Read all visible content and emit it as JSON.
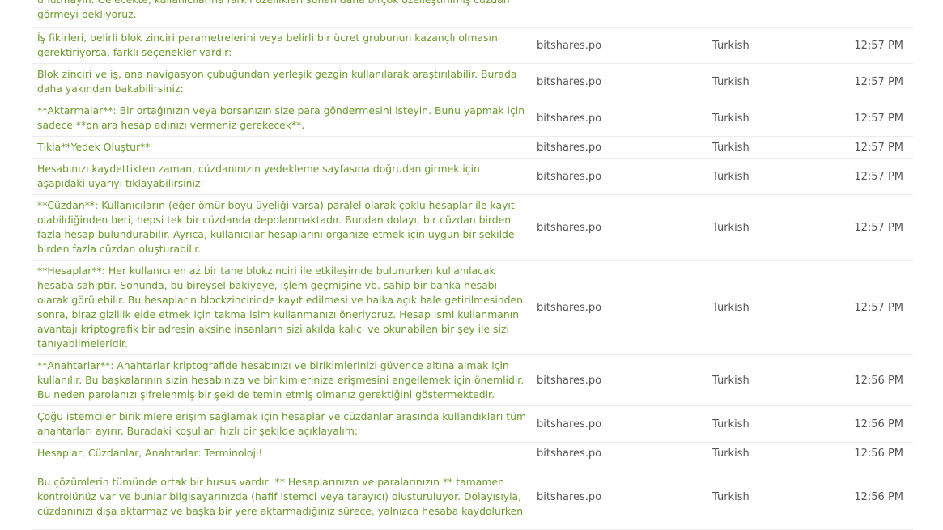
{
  "rows": [
    {
      "text": "unutmayın. Gelecekte, kullanıcılarına farklı özellikleri sunan daha birçok özelleştirilmiş cüzdan görmeyi bekliyoruz.",
      "project": "",
      "language": "",
      "time": ""
    },
    {
      "text": "İş fikirleri, belirli blok zinciri parametrelerini veya belirli bir ücret grubunun kazançlı olmasını gerektiriyorsa, farklı seçenekler vardır:",
      "project": "bitshares.po",
      "language": "Turkish",
      "time": "12:57 PM"
    },
    {
      "text": "Blok zinciri ve iş, ana navigasyon çubuğundan yerleşik gezgin kullanılarak araştırılabilir. Burada daha yakından bakabilirsiniz:",
      "project": "bitshares.po",
      "language": "Turkish",
      "time": "12:57 PM"
    },
    {
      "text": "**Aktarmalar**: Bir ortağınızın veya borsanızın size para göndermesini isteyin. Bunu yapmak için sadece **onlara hesap adınızı vermeniz gerekecek**.",
      "project": "bitshares.po",
      "language": "Turkish",
      "time": "12:57 PM"
    },
    {
      "text": "Tıkla**Yedek Oluştur**",
      "project": "bitshares.po",
      "language": "Turkish",
      "time": "12:57 PM"
    },
    {
      "text": "Hesabınızı kaydettikten zaman, cüzdanınızın yedekleme sayfasına doğrudan girmek için aşapıdaki uyarıyı tıklayabilirsiniz:",
      "project": "bitshares.po",
      "language": "Turkish",
      "time": "12:57 PM"
    },
    {
      "text": "**Cüzdan**: Kullanıcıların (eğer ömür boyu üyeliği varsa) paralel olarak çoklu hesaplar ile kayıt olabildiğinden beri, hepsi tek bir cüzdanda depolanmaktadır. Bundan dolayı, bir cüzdan birden fazla hesap bulundurabilir. Ayrıca, kullanıcılar hesaplarını organize etmek için uygun bir şekilde birden fazla cüzdan oluşturabilir.",
      "project": "bitshares.po",
      "language": "Turkish",
      "time": "12:57 PM"
    },
    {
      "text": "**Hesaplar**: Her kullanıcı en az bir tane blokzinciri ile etkileşimde bulunurken kullanılacak hesaba sahiptir. Sonunda, bu bireysel bakiyeye, işlem geçmişine vb. sahip bir banka hesabı olarak görülebilir. Bu hesapların blockzincirinde kayıt edilmesi ve halka açık hale getirilmesinden sonra, biraz gizlilik elde etmek için takma isim kullanmanızı öneriyoruz. Hesap ismi kullanmanın avantajı kriptografik bir adresin aksine insanların sizi akılda kalıcı ve okunabilen bir şey ile sizi tanıyabilmeleridir.",
      "project": "bitshares.po",
      "language": "Turkish",
      "time": "12:57 PM"
    },
    {
      "text": "**Anahtarlar**: Anahtarlar kriptografide hesabınızı ve birikimlerinizi güvence altına almak için kullanılır. Bu başkalarının sizin hesabınıza ve birikimlerinize erişmesini engellemek için önemlidir. Bu neden parolanızı şifrelenmiş bir şekilde temin etmiş olmanız gerektiğini göstermektedir.",
      "project": "bitshares.po",
      "language": "Turkish",
      "time": "12:56 PM"
    },
    {
      "text": "Çoğu istemciler birikimlere erişim sağlamak için hesaplar ve cüzdanlar arasında kullandıkları tüm anahtarları ayırır. Buradaki koşulları hızlı bir şekilde açıklayalım:",
      "project": "bitshares.po",
      "language": "Turkish",
      "time": "12:56 PM"
    },
    {
      "text": "Hesaplar, Cüzdanlar, Anahtarlar: Terminoloji!",
      "project": "bitshares.po",
      "language": "Turkish",
      "time": "12:56 PM"
    },
    {
      "text": "Bu çözümlerin tümünde ortak bir husus vardır: ** Hesaplarınızın ve paralarınızın ** tamamen kontrolünüz var ve bunlar bilgisayarınızda (hafif istemci veya tarayıcı) oluşturuluyor. Dolayısıyla, cüzdanınızı dışa aktarmaz ve başka bir yere aktarmadığınız sürece, yalnızca hesaba kaydolurken",
      "project": "bitshares.po",
      "language": "Turkish",
      "time": "12:56 PM"
    }
  ],
  "colors": {
    "link_text": "#6a9a2c",
    "meta_text": "#555555",
    "row_border": "#ececec"
  }
}
